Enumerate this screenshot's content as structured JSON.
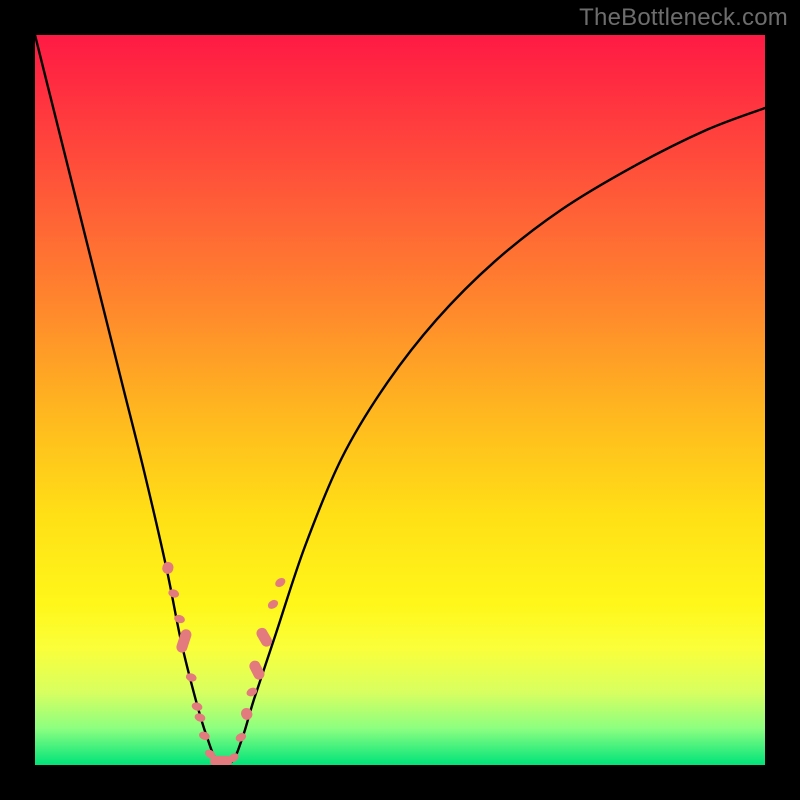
{
  "watermark": "TheBottleneck.com",
  "chart_data": {
    "type": "line",
    "title": "",
    "xlabel": "",
    "ylabel": "",
    "xlim": [
      0,
      100
    ],
    "ylim": [
      0,
      100
    ],
    "series": [
      {
        "name": "bottleneck-curve",
        "x": [
          0,
          3,
          6,
          9,
          12,
          15,
          18,
          20,
          22,
          23.5,
          25,
          27,
          28.5,
          30,
          33,
          37,
          42,
          48,
          55,
          63,
          72,
          82,
          92,
          100
        ],
        "y": [
          100,
          88,
          76,
          64,
          52,
          40,
          27,
          17,
          9,
          4,
          0.5,
          0.5,
          4,
          9,
          18,
          30,
          42,
          52,
          61,
          69,
          76,
          82,
          87,
          90
        ]
      }
    ],
    "markers": {
      "name": "highlight-beads",
      "stroke": "#e37a7e",
      "segments": [
        {
          "x": 18.2,
          "y": 27.0,
          "len": 12,
          "angle": 72
        },
        {
          "x": 19.0,
          "y": 23.5,
          "len": 8,
          "angle": 72
        },
        {
          "x": 19.8,
          "y": 20.0,
          "len": 8,
          "angle": 72
        },
        {
          "x": 20.4,
          "y": 17.0,
          "len": 24,
          "angle": 72
        },
        {
          "x": 21.4,
          "y": 12.0,
          "len": 8,
          "angle": 72
        },
        {
          "x": 22.2,
          "y": 8.0,
          "len": 8,
          "angle": 72
        },
        {
          "x": 22.6,
          "y": 6.5,
          "len": 8,
          "angle": 72
        },
        {
          "x": 23.2,
          "y": 4.0,
          "len": 8,
          "angle": 72
        },
        {
          "x": 24.0,
          "y": 1.5,
          "len": 8,
          "angle": 60
        },
        {
          "x": 25.5,
          "y": 0.5,
          "len": 22,
          "angle": 0
        },
        {
          "x": 27.2,
          "y": 1.0,
          "len": 8,
          "angle": -55
        },
        {
          "x": 28.2,
          "y": 3.8,
          "len": 8,
          "angle": -63
        },
        {
          "x": 29.0,
          "y": 7.0,
          "len": 12,
          "angle": -63
        },
        {
          "x": 29.7,
          "y": 10.0,
          "len": 8,
          "angle": -63
        },
        {
          "x": 30.4,
          "y": 13.0,
          "len": 20,
          "angle": -63
        },
        {
          "x": 31.4,
          "y": 17.5,
          "len": 20,
          "angle": -60
        },
        {
          "x": 32.6,
          "y": 22.0,
          "len": 8,
          "angle": -58
        },
        {
          "x": 33.6,
          "y": 25.0,
          "len": 8,
          "angle": -56
        }
      ]
    }
  }
}
